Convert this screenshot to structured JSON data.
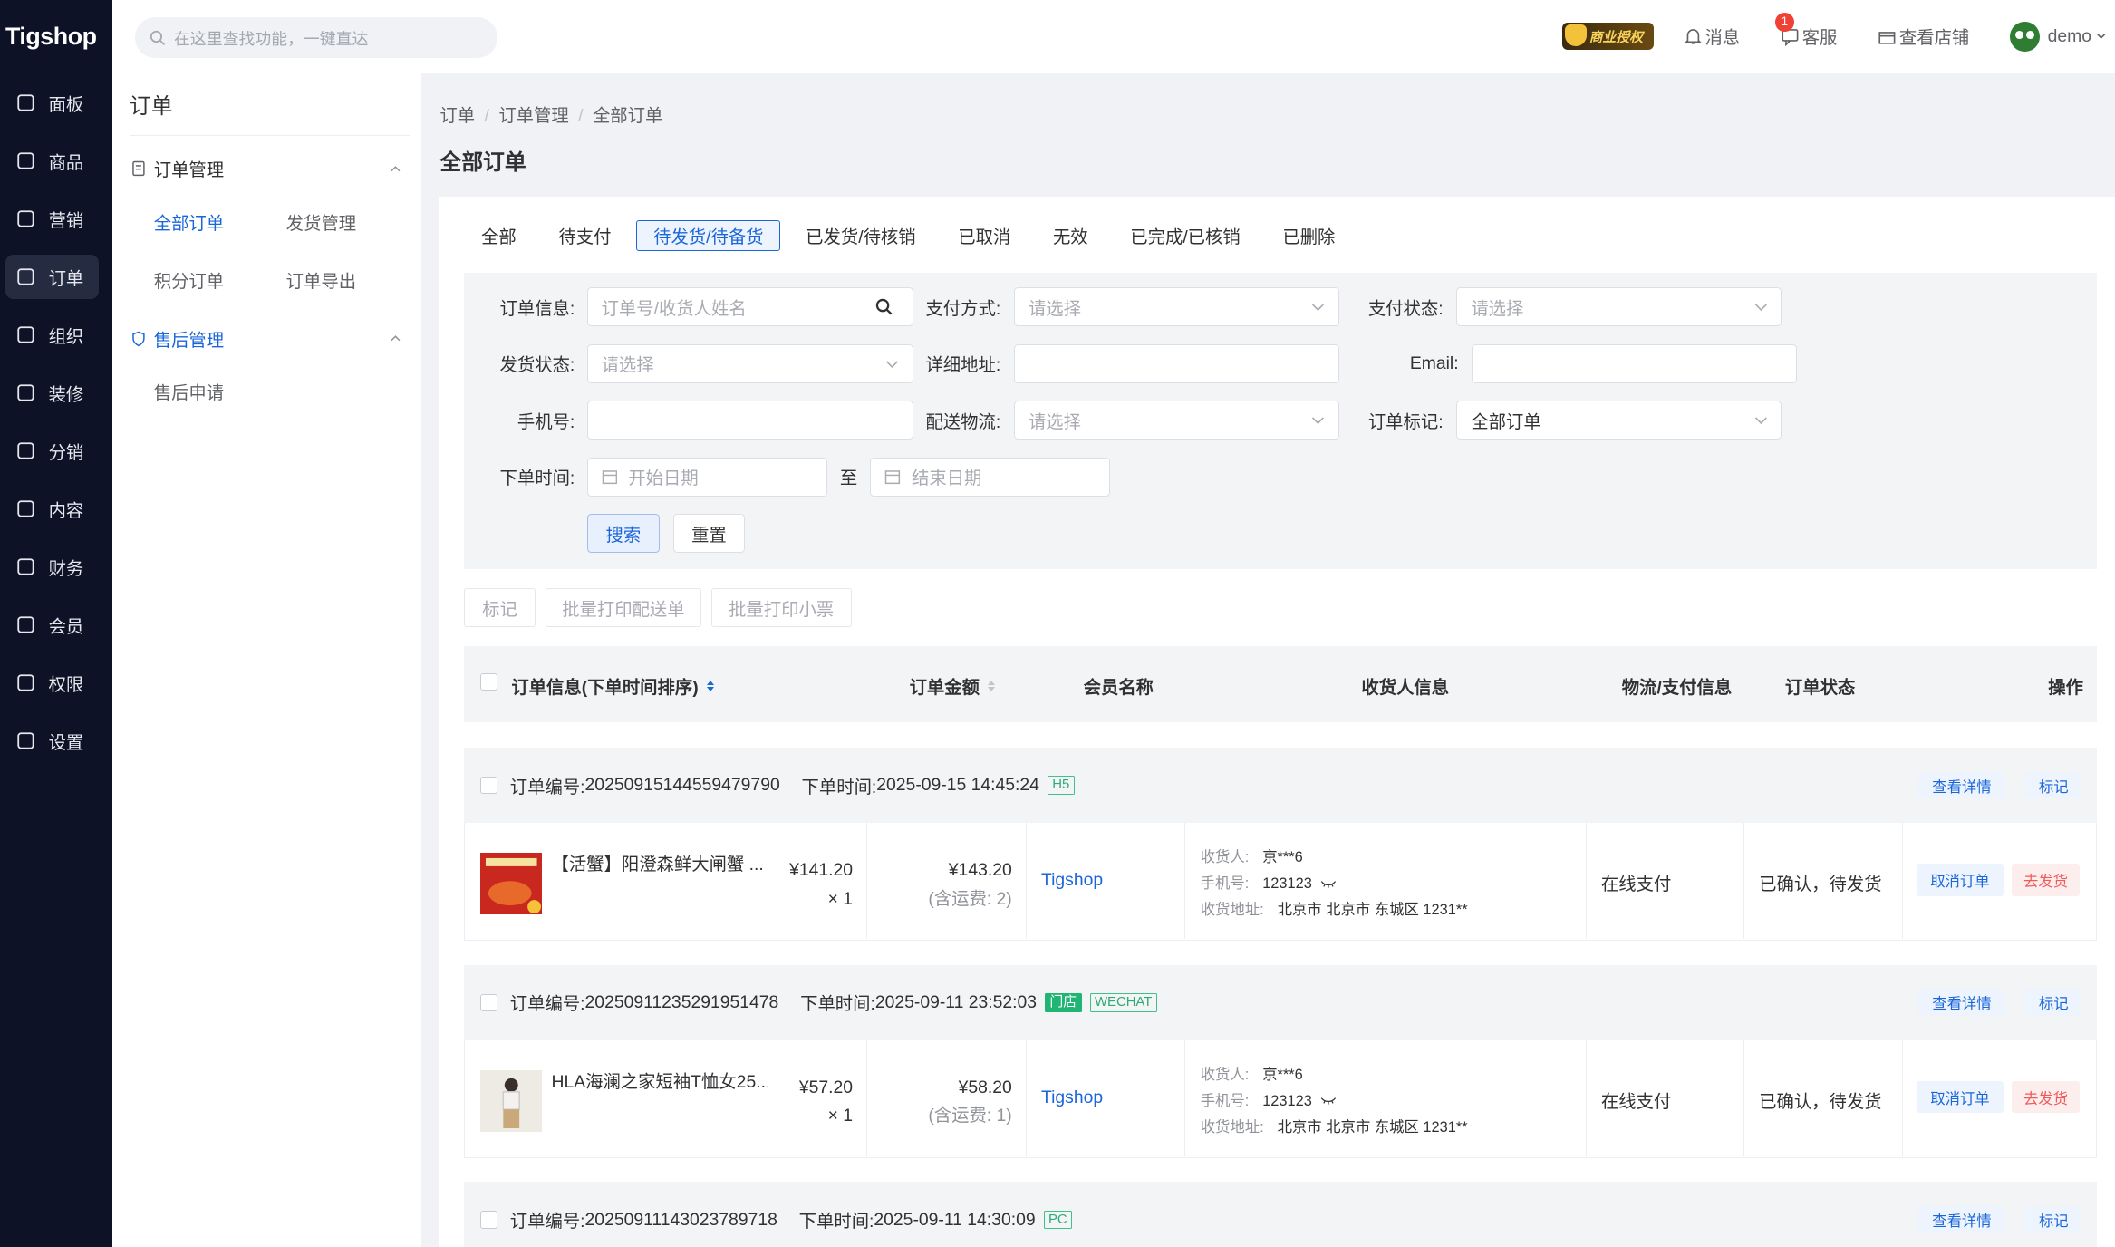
{
  "app": {
    "logo": "Tigshop"
  },
  "sidebar": {
    "items": [
      {
        "label": "面板"
      },
      {
        "label": "商品"
      },
      {
        "label": "营销"
      },
      {
        "label": "订单"
      },
      {
        "label": "组织"
      },
      {
        "label": "装修"
      },
      {
        "label": "分销"
      },
      {
        "label": "内容"
      },
      {
        "label": "财务"
      },
      {
        "label": "会员"
      },
      {
        "label": "权限"
      },
      {
        "label": "设置"
      }
    ],
    "active_index": 3
  },
  "topbar": {
    "search_placeholder": "在这里查找功能，一键直达",
    "auth_badge": "商业授权",
    "messages": "消息",
    "service": "客服",
    "service_count": "1",
    "view_store": "查看店铺",
    "user": "demo"
  },
  "submenu": {
    "title": "订单",
    "group1": {
      "label": "订单管理",
      "items": [
        "全部订单",
        "发货管理",
        "积分订单",
        "订单导出"
      ]
    },
    "group2": {
      "label": "售后管理",
      "items": [
        "售后申请"
      ]
    }
  },
  "breadcrumb": [
    "订单",
    "订单管理",
    "全部订单"
  ],
  "page_title": "全部订单",
  "tabs": [
    "全部",
    "待支付",
    "待发货/待备货",
    "已发货/待核销",
    "已取消",
    "无效",
    "已完成/已核销",
    "已删除"
  ],
  "active_tab": 2,
  "filter": {
    "order_info_label": "订单信息:",
    "order_info_placeholder": "订单号/收货人姓名",
    "pay_method_label": "支付方式:",
    "pay_status_label": "支付状态:",
    "ship_status_label": "发货状态:",
    "address_label": "详细地址:",
    "email_label": "Email:",
    "phone_label": "手机号:",
    "logistics_label": "配送物流:",
    "mark_label": "订单标记:",
    "mark_value": "全部订单",
    "select_placeholder": "请选择",
    "time_label": "下单时间:",
    "start_placeholder": "开始日期",
    "end_placeholder": "结束日期",
    "to": "至",
    "search_btn": "搜索",
    "reset_btn": "重置"
  },
  "batch": {
    "mark": "标记",
    "print_delivery": "批量打印配送单",
    "print_receipt": "批量打印小票"
  },
  "table_header": {
    "order_info": "订单信息(下单时间排序)",
    "amount": "订单金额",
    "member": "会员名称",
    "receiver": "收货人信息",
    "logistics": "物流/支付信息",
    "status": "订单状态",
    "action": "操作"
  },
  "orders": [
    {
      "sn_label": "订单编号:",
      "sn": "20250915144559479790",
      "time_label": "下单时间:",
      "time": "2025-09-15 14:45:24",
      "tags": [
        "H5"
      ],
      "product": "【活蟹】阳澄森鲜大闸蟹 ...",
      "price": "¥141.20",
      "qty": "× 1",
      "total": "¥143.20",
      "shipping": "(含运费: 2)",
      "member": "Tigshop",
      "receiver_k": "收货人:",
      "receiver": "京***6",
      "phone_k": "手机号:",
      "phone": "123123",
      "addr_k": "收货地址:",
      "addr": "北京市 北京市 东城区 1231**",
      "pay": "在线支付",
      "status": "已确认，待发货",
      "view": "查看详情",
      "mark": "标记",
      "cancel": "取消订单",
      "ship": "去发货"
    },
    {
      "sn_label": "订单编号:",
      "sn": "20250911235291951478",
      "time_label": "下单时间:",
      "time": "2025-09-11 23:52:03",
      "tags": [
        "门店",
        "WECHAT"
      ],
      "product": "HLA海澜之家短袖T恤女25...",
      "price": "¥57.20",
      "qty": "× 1",
      "total": "¥58.20",
      "shipping": "(含运费: 1)",
      "member": "Tigshop",
      "receiver_k": "收货人:",
      "receiver": "京***6",
      "phone_k": "手机号:",
      "phone": "123123",
      "addr_k": "收货地址:",
      "addr": "北京市 北京市 东城区 1231**",
      "pay": "在线支付",
      "status": "已确认，待发货",
      "view": "查看详情",
      "mark": "标记",
      "cancel": "取消订单",
      "ship": "去发货"
    },
    {
      "sn_label": "订单编号:",
      "sn": "20250911143023789718",
      "time_label": "下单时间:",
      "time": "2025-09-11 14:30:09",
      "tags": [
        "PC"
      ],
      "view": "查看详情",
      "mark": "标记"
    }
  ]
}
